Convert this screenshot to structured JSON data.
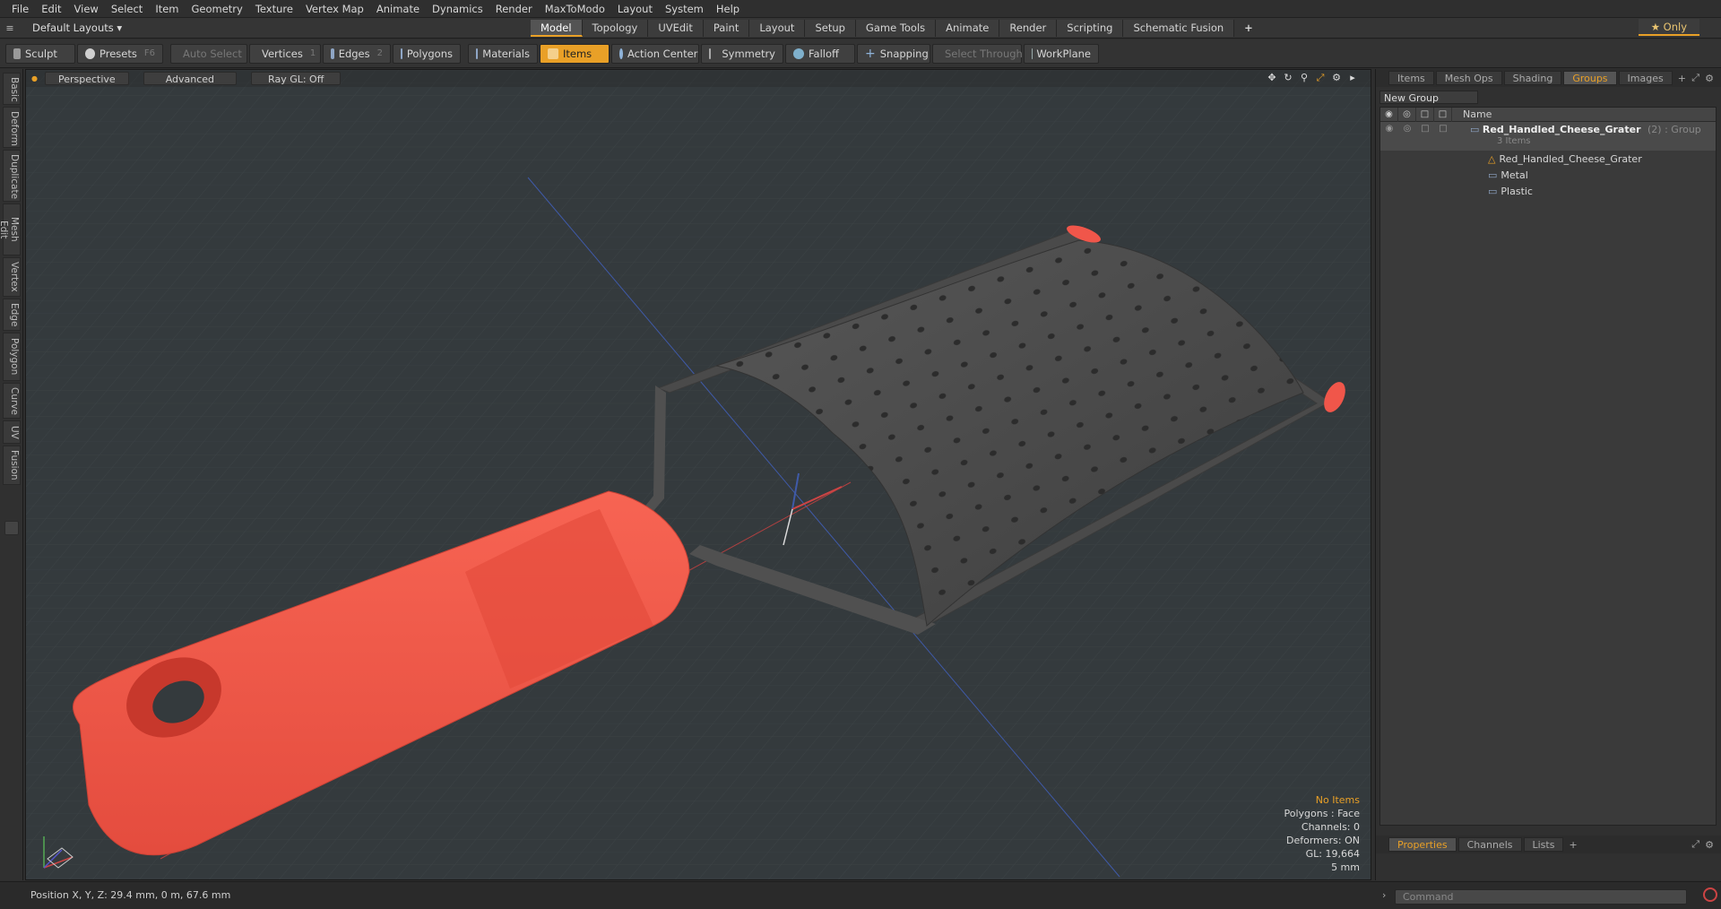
{
  "menu": [
    "File",
    "Edit",
    "View",
    "Select",
    "Item",
    "Geometry",
    "Texture",
    "Vertex Map",
    "Animate",
    "Dynamics",
    "Render",
    "MaxToModo",
    "Layout",
    "System",
    "Help"
  ],
  "layout_selector": "Default Layouts ▾",
  "mode_tabs": [
    "Model",
    "Topology",
    "UVEdit",
    "Paint",
    "Layout",
    "Setup",
    "Game Tools",
    "Animate",
    "Render",
    "Scripting",
    "Schematic Fusion"
  ],
  "mode_add": "+",
  "only_label": "★ Only",
  "toolbar": {
    "sculpt": "Sculpt",
    "presets": "Presets",
    "presets_key": "F6",
    "auto_select": "Auto Select",
    "vertices": "Vertices",
    "vertices_num": "1",
    "edges": "Edges",
    "edges_num": "2",
    "polygons": "Polygons",
    "materials": "Materials",
    "items": "Items",
    "action_center": "Action Center",
    "symmetry": "Symmetry",
    "falloff": "Falloff",
    "snapping": "Snapping",
    "select_through": "Select Through",
    "workplane": "WorkPlane"
  },
  "left_tabs": [
    "Basic",
    "Deform",
    "Duplicate",
    "Mesh Edit",
    "Vertex",
    "Edge",
    "Polygon",
    "Curve",
    "UV",
    "Fusion"
  ],
  "viewport": {
    "perspective": "Perspective",
    "advanced": "Advanced",
    "raygl": "Ray GL: Off"
  },
  "stats": {
    "no_items": "No Items",
    "polygons": "Polygons : Face",
    "channels": "Channels: 0",
    "deformers": "Deformers: ON",
    "gl": "GL: 19,664",
    "scale": "5 mm"
  },
  "right_tabs": [
    "Items",
    "Mesh Ops",
    "Shading",
    "Groups",
    "Images"
  ],
  "right_tab_add": "+",
  "new_group": "New Group",
  "tree": {
    "col_name": "Name",
    "group_name": "Red_Handled_Cheese_Grater",
    "group_meta": "(2) : Group",
    "group_count": "3 Items",
    "children": [
      "Red_Handled_Cheese_Grater",
      "Metal",
      "Plastic"
    ]
  },
  "bottom_tabs": [
    "Properties",
    "Channels",
    "Lists"
  ],
  "bottom_add": "+",
  "command_placeholder": "Command",
  "status": "Position X, Y, Z:   29.4 mm, 0 m, 67.6 mm",
  "colors": {
    "accent": "#e9a027",
    "handle": "#f0564a",
    "metal": "#4a4a4a"
  }
}
